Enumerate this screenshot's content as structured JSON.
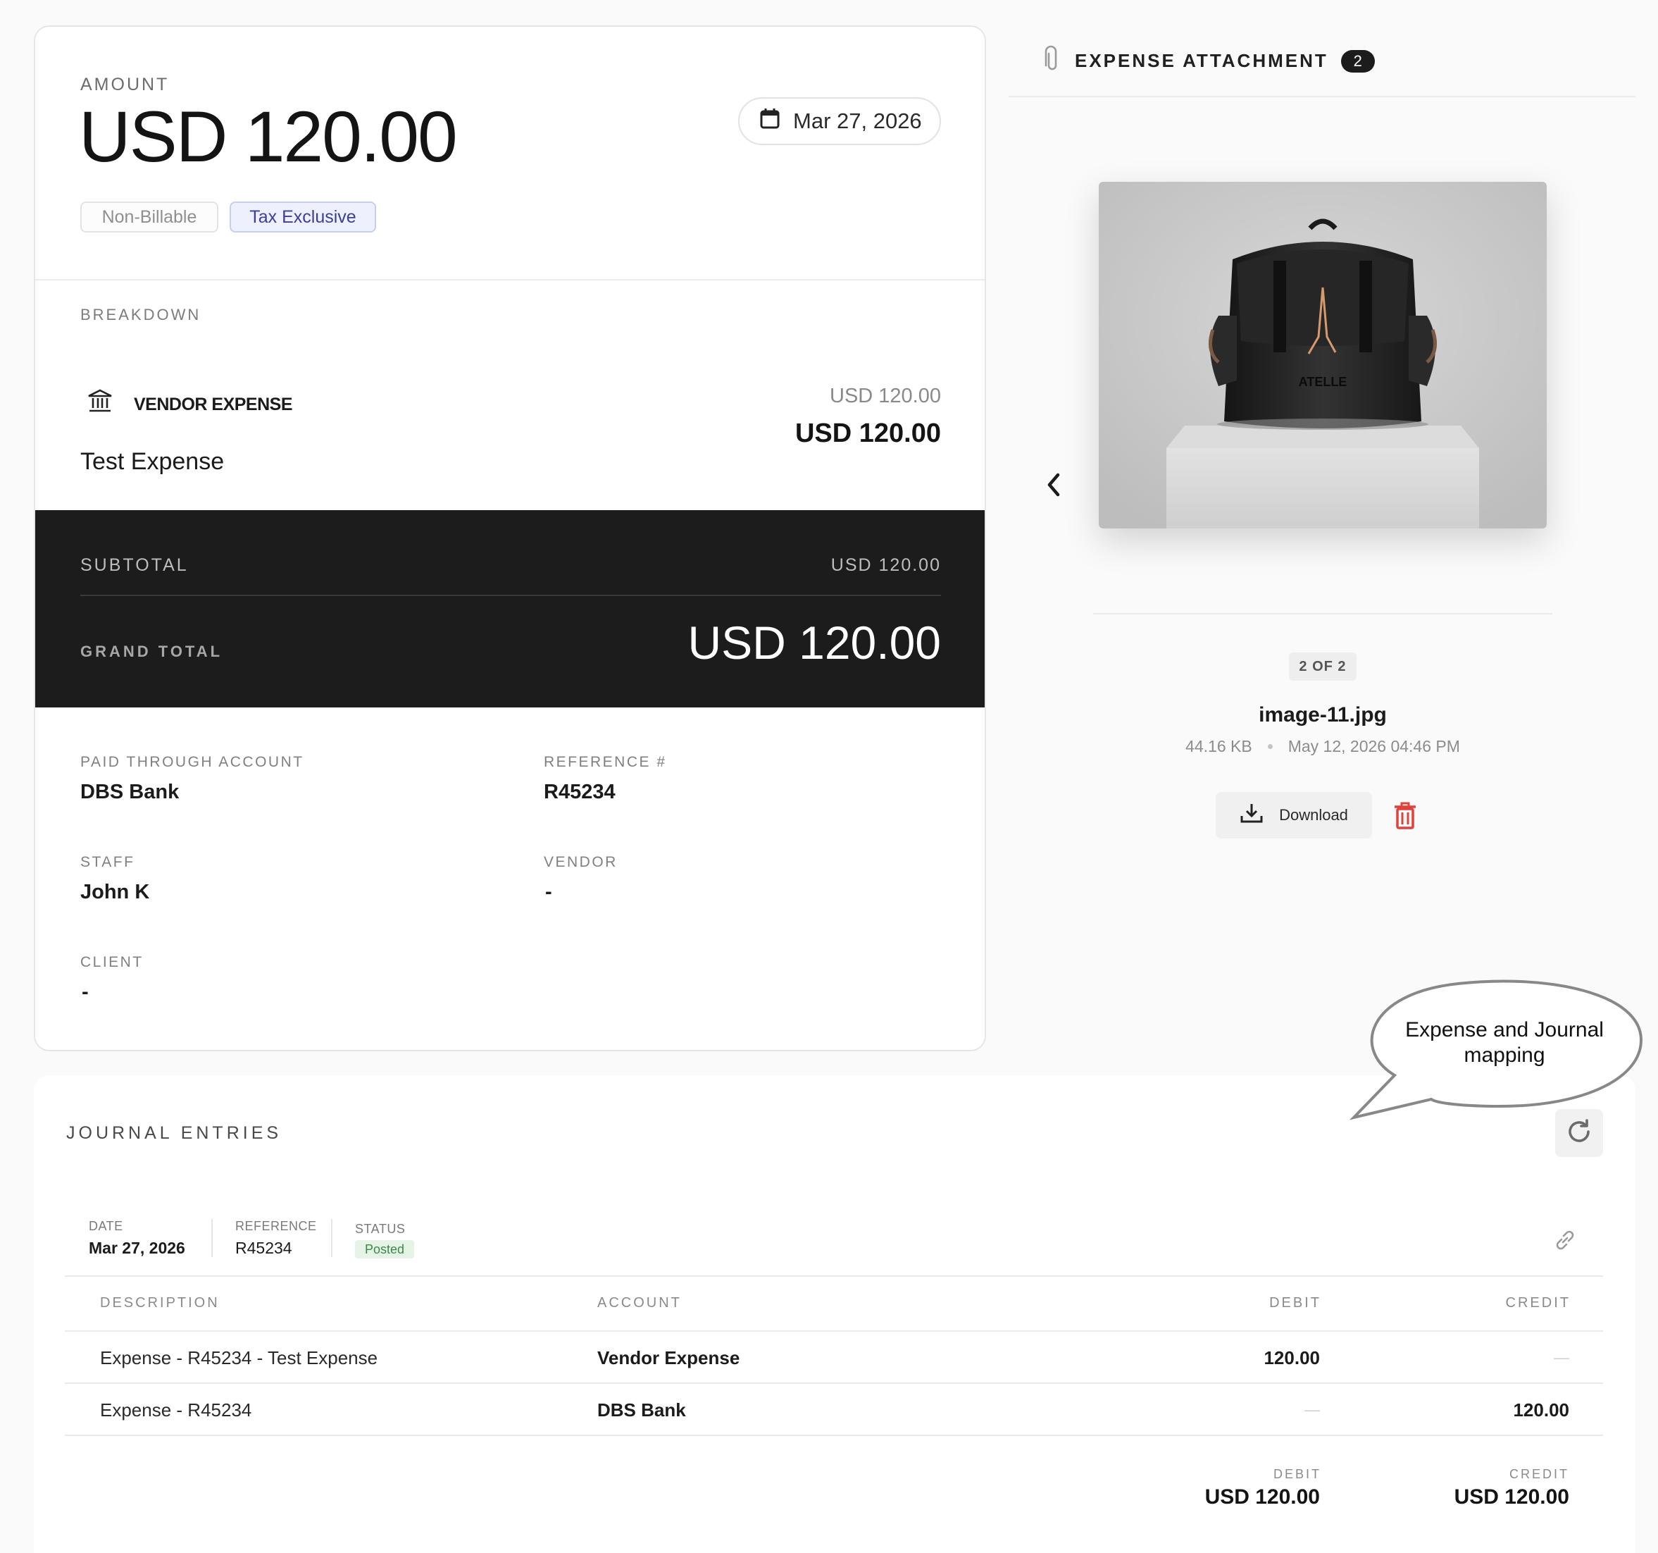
{
  "expense": {
    "amount_label": "AMOUNT",
    "amount_value": "USD 120.00",
    "date": "Mar 27, 2026",
    "tags": {
      "non_billable": "Non-Billable",
      "tax_exclusive": "Tax Exclusive"
    },
    "breakdown_label": "BREAKDOWN",
    "line": {
      "category": "VENDOR EXPENSE",
      "description": "Test Expense",
      "amount_small": "USD 120.00",
      "amount_large": "USD 120.00"
    },
    "subtotal_label": "SUBTOTAL",
    "subtotal_value": "USD 120.00",
    "grand_total_label": "GRAND TOTAL",
    "grand_total_value": "USD 120.00",
    "fields": {
      "paid_through_label": "PAID THROUGH ACCOUNT",
      "paid_through_value": "DBS Bank",
      "reference_label": "REFERENCE #",
      "reference_value": "R45234",
      "staff_label": "STAFF",
      "staff_value": "John K",
      "vendor_label": "VENDOR",
      "vendor_value": "-",
      "client_label": "CLIENT",
      "client_value": "-"
    }
  },
  "attachment": {
    "title": "EXPENSE ATTACHMENT",
    "count": "2",
    "page_counter": "2 OF 2",
    "file_name": "image-11.jpg",
    "file_size": "44.16 KB",
    "uploaded_at": "May 12, 2026 04:46 PM",
    "download_label": "Download",
    "preview_brand": "ATELLE"
  },
  "callout": {
    "text": "Expense and Journal mapping"
  },
  "journal": {
    "title": "JOURNAL ENTRIES",
    "meta": {
      "date_label": "DATE",
      "date_value": "Mar 27, 2026",
      "reference_label": "REFERENCE",
      "reference_value": "R45234",
      "status_label": "STATUS",
      "status_value": "Posted"
    },
    "columns": {
      "description": "DESCRIPTION",
      "account": "ACCOUNT",
      "debit": "DEBIT",
      "credit": "CREDIT"
    },
    "rows": [
      {
        "description": "Expense - R45234 - Test Expense",
        "account": "Vendor Expense",
        "debit": "120.00",
        "credit": "—"
      },
      {
        "description": "Expense - R45234",
        "account": "DBS Bank",
        "debit": "—",
        "credit": "120.00"
      }
    ],
    "totals": {
      "debit_label": "DEBIT",
      "debit_value": "USD 120.00",
      "credit_label": "CREDIT",
      "credit_value": "USD 120.00"
    }
  },
  "colors": {
    "dark_band": "#1c1c1c",
    "tax_tag_bg": "#eef0fd",
    "tax_tag_text": "#3c3f9a",
    "status_posted_bg": "#e6f4e8",
    "status_posted_text": "#3a8a45",
    "delete_red": "#e0413b"
  }
}
